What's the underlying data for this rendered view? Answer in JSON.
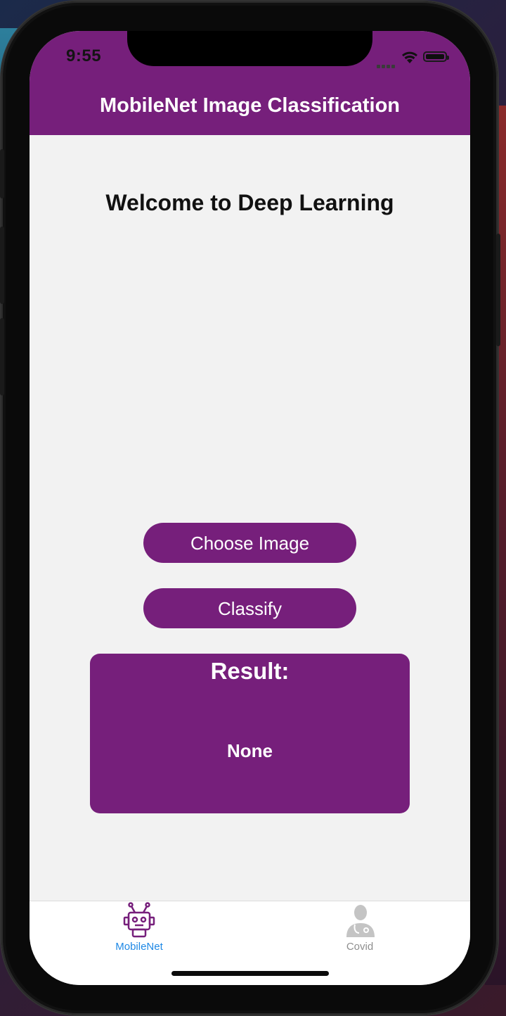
{
  "status_bar": {
    "time": "9:55"
  },
  "nav": {
    "title": "MobileNet Image Classification"
  },
  "main": {
    "welcome": "Welcome to Deep Learning",
    "choose_label": "Choose Image",
    "classify_label": "Classify",
    "result_title": "Result:",
    "result_value": "None"
  },
  "tabs": [
    {
      "label": "MobileNet",
      "icon": "robot-icon",
      "active": true
    },
    {
      "label": "Covid",
      "icon": "doctor-icon",
      "active": false
    }
  ],
  "colors": {
    "accent": "#761f7b",
    "tab_active": "#1e88e5",
    "tab_inactive": "#8e8e8e",
    "screen_bg": "#f2f2f2"
  }
}
